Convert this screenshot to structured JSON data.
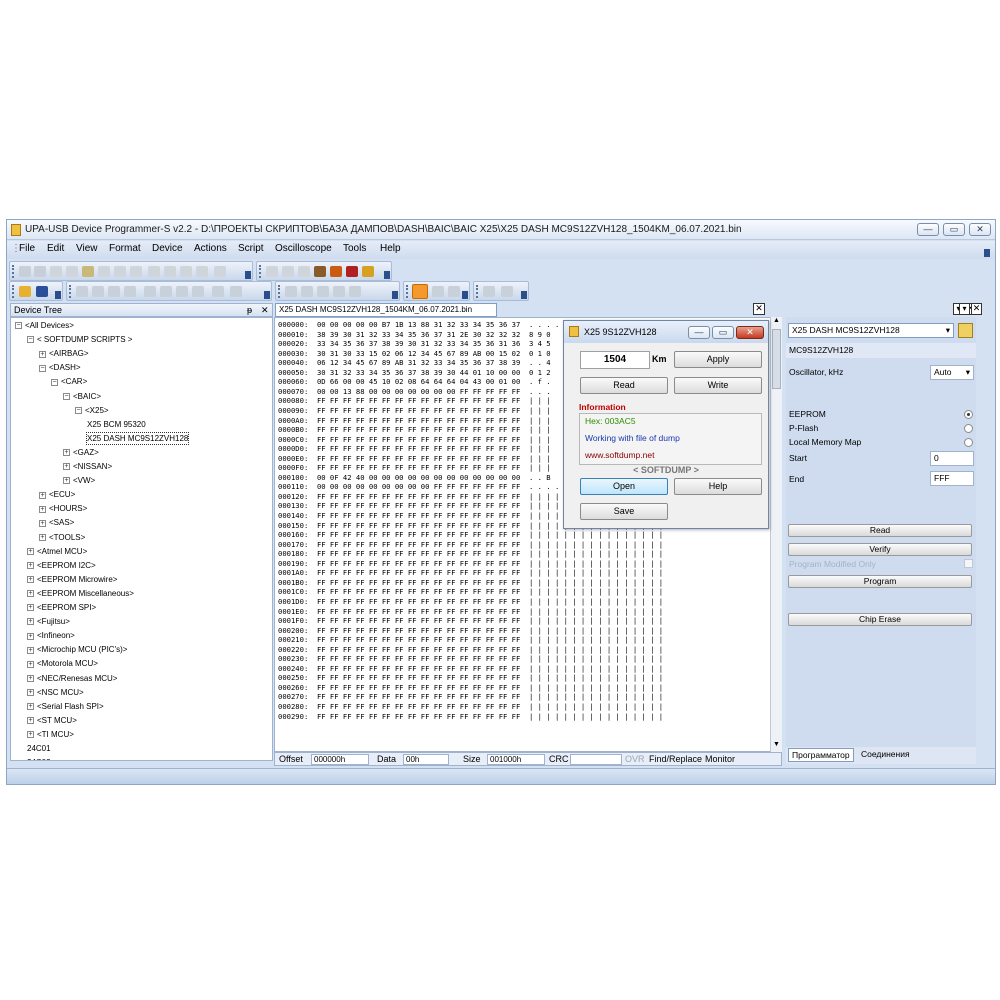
{
  "window": {
    "title": "UPA-USB Device Programmer-S v2.2 - D:\\ПРОЕКТЫ СКРИПТОВ\\БАЗА ДАМПОВ\\DASH\\BAIC\\BAIC X25\\X25 DASH MC9S12ZVH128_1504KM_06.07.2021.bin",
    "minimize": "—",
    "maximize": "▭",
    "close": "✕"
  },
  "menu": [
    "File",
    "Edit",
    "View",
    "Format",
    "Device",
    "Actions",
    "Script",
    "Oscilloscope",
    "Tools",
    "Help"
  ],
  "device_tree": {
    "title": "Device Tree",
    "pin": "ᵽ",
    "close": "✕",
    "nodes": [
      {
        "label": "<All Devices>",
        "level": 0,
        "box": "−"
      },
      {
        "label": "< SOFTDUMP SCRIPTS >",
        "level": 1,
        "box": "−"
      },
      {
        "label": "<AIRBAG>",
        "level": 2,
        "box": "+"
      },
      {
        "label": "<DASH>",
        "level": 2,
        "box": "−"
      },
      {
        "label": "<CAR>",
        "level": 3,
        "box": "−"
      },
      {
        "label": "<BAIC>",
        "level": 4,
        "box": "−"
      },
      {
        "label": "<X25>",
        "level": 5,
        "box": "−"
      },
      {
        "label": "X25 BCM 95320",
        "level": 6,
        "box": ""
      },
      {
        "label": "X25 DASH MC9S12ZVH128",
        "level": 6,
        "box": "",
        "selected": true
      },
      {
        "label": "<GAZ>",
        "level": 4,
        "box": "+"
      },
      {
        "label": "<NISSAN>",
        "level": 4,
        "box": "+"
      },
      {
        "label": "<VW>",
        "level": 4,
        "box": "+"
      },
      {
        "label": "<ECU>",
        "level": 2,
        "box": "+"
      },
      {
        "label": "<HOURS>",
        "level": 2,
        "box": "+"
      },
      {
        "label": "<SAS>",
        "level": 2,
        "box": "+"
      },
      {
        "label": "<TOOLS>",
        "level": 2,
        "box": "+"
      },
      {
        "label": "<Atmel MCU>",
        "level": 1,
        "box": "+"
      },
      {
        "label": "<EEPROM I2C>",
        "level": 1,
        "box": "+"
      },
      {
        "label": "<EEPROM Microwire>",
        "level": 1,
        "box": "+"
      },
      {
        "label": "<EEPROM Miscellaneous>",
        "level": 1,
        "box": "+"
      },
      {
        "label": "<EEPROM SPI>",
        "level": 1,
        "box": "+"
      },
      {
        "label": "<Fujitsu>",
        "level": 1,
        "box": "+"
      },
      {
        "label": "<Infineon>",
        "level": 1,
        "box": "+"
      },
      {
        "label": "<Microchip MCU (PIC's)>",
        "level": 1,
        "box": "+"
      },
      {
        "label": "<Motorola MCU>",
        "level": 1,
        "box": "+"
      },
      {
        "label": "<NEC/Renesas MCU>",
        "level": 1,
        "box": "+"
      },
      {
        "label": "<NSC MCU>",
        "level": 1,
        "box": "+"
      },
      {
        "label": "<Serial Flash SPI>",
        "level": 1,
        "box": "+"
      },
      {
        "label": "<ST MCU>",
        "level": 1,
        "box": "+"
      },
      {
        "label": "<TI MCU>",
        "level": 1,
        "box": "+"
      },
      {
        "label": "24C01",
        "level": 1,
        "box": ""
      },
      {
        "label": "24C02",
        "level": 1,
        "box": ""
      }
    ]
  },
  "editor": {
    "tab_label": "X25 DASH MC9S12ZVH128_1504KM_06.07.2021.bin",
    "tab_close": "✕",
    "hex_rows": [
      "000000:  00 00 00 00 00 B7 1B 13 88 31 32 33 34 35 36 37  . . . .",
      "000010:  38 39 30 31 32 33 34 35 36 37 31 2E 30 32 32 32  8 9 0",
      "000020:  33 34 35 36 37 38 39 30 31 32 33 34 35 36 31 36  3 4 5",
      "000030:  30 31 30 33 15 02 06 12 34 45 67 89 AB 00 15 02  0 1 0",
      "000040:  06 12 34 45 67 89 AB 31 32 33 34 35 36 37 38 39  . . 4",
      "000050:  30 31 32 33 34 35 36 37 38 39 30 44 01 10 00 00  0 1 2",
      "000060:  0D 66 00 00 45 10 02 08 64 64 64 04 43 00 01 00  . f .",
      "000070:  00 00 13 88 00 00 00 00 00 00 00 FF FF FF FF FF  . . .",
      "000080:  FF FF FF FF FF FF FF FF FF FF FF FF FF FF FF FF  | | |",
      "000090:  FF FF FF FF FF FF FF FF FF FF FF FF FF FF FF FF  | | |",
      "0000A0:  FF FF FF FF FF FF FF FF FF FF FF FF FF FF FF FF  | | |",
      "0000B0:  FF FF FF FF FF FF FF FF FF FF FF FF FF FF FF FF  | | |",
      "0000C0:  FF FF FF FF FF FF FF FF FF FF FF FF FF FF FF FF  | | |",
      "0000D0:  FF FF FF FF FF FF FF FF FF FF FF FF FF FF FF FF  | | |",
      "0000E0:  FF FF FF FF FF FF FF FF FF FF FF FF FF FF FF FF  | | |",
      "0000F0:  FF FF FF FF FF FF FF FF FF FF FF FF FF FF FF FF  | | |",
      "000100:  00 0F 42 40 00 00 00 00 00 00 00 00 00 00 00 00  . . B",
      "000110:  00 00 00 00 00 00 00 00 00 FF FF FF FF FF FF FF  . . . . . . . . . | | | | | | |",
      "000120:  FF FF FF FF FF FF FF FF FF FF FF FF FF FF FF FF  | | | | | | | | | | | | | | | |",
      "000130:  FF FF FF FF FF FF FF FF FF FF FF FF FF FF FF FF  | | | | | | | | | | | | | | | |",
      "000140:  FF FF FF FF FF FF FF FF FF FF FF FF FF FF FF FF  | | | | | | | | | | | | | | | |",
      "000150:  FF FF FF FF FF FF FF FF FF FF FF FF FF FF FF FF  | | | | | | | | | | | | | | | |",
      "000160:  FF FF FF FF FF FF FF FF FF FF FF FF FF FF FF FF  | | | | | | | | | | | | | | | |",
      "000170:  FF FF FF FF FF FF FF FF FF FF FF FF FF FF FF FF  | | | | | | | | | | | | | | | |",
      "000180:  FF FF FF FF FF FF FF FF FF FF FF FF FF FF FF FF  | | | | | | | | | | | | | | | |",
      "000190:  FF FF FF FF FF FF FF FF FF FF FF FF FF FF FF FF  | | | | | | | | | | | | | | | |",
      "0001A0:  FF FF FF FF FF FF FF FF FF FF FF FF FF FF FF FF  | | | | | | | | | | | | | | | |",
      "0001B0:  FF FF FF FF FF FF FF FF FF FF FF FF FF FF FF FF  | | | | | | | | | | | | | | | |",
      "0001C0:  FF FF FF FF FF FF FF FF FF FF FF FF FF FF FF FF  | | | | | | | | | | | | | | | |",
      "0001D0:  FF FF FF FF FF FF FF FF FF FF FF FF FF FF FF FF  | | | | | | | | | | | | | | | |",
      "0001E0:  FF FF FF FF FF FF FF FF FF FF FF FF FF FF FF FF  | | | | | | | | | | | | | | | |",
      "0001F0:  FF FF FF FF FF FF FF FF FF FF FF FF FF FF FF FF  | | | | | | | | | | | | | | | |",
      "000200:  FF FF FF FF FF FF FF FF FF FF FF FF FF FF FF FF  | | | | | | | | | | | | | | | |",
      "000210:  FF FF FF FF FF FF FF FF FF FF FF FF FF FF FF FF  | | | | | | | | | | | | | | | |",
      "000220:  FF FF FF FF FF FF FF FF FF FF FF FF FF FF FF FF  | | | | | | | | | | | | | | | |",
      "000230:  FF FF FF FF FF FF FF FF FF FF FF FF FF FF FF FF  | | | | | | | | | | | | | | | |",
      "000240:  FF FF FF FF FF FF FF FF FF FF FF FF FF FF FF FF  | | | | | | | | | | | | | | | |",
      "000250:  FF FF FF FF FF FF FF FF FF FF FF FF FF FF FF FF  | | | | | | | | | | | | | | | |",
      "000260:  FF FF FF FF FF FF FF FF FF FF FF FF FF FF FF FF  | | | | | | | | | | | | | | | |",
      "000270:  FF FF FF FF FF FF FF FF FF FF FF FF FF FF FF FF  | | | | | | | | | | | | | | | |",
      "000280:  FF FF FF FF FF FF FF FF FF FF FF FF FF FF FF FF  | | | | | | | | | | | | | | | |",
      "000290:  FF FF FF FF FF FF FF FF FF FF FF FF FF FF FF FF  | | | | | | | | | | | | | | | |"
    ],
    "status": {
      "offset_label": "Offset",
      "offset_value": "000000h",
      "data_label": "Data",
      "data_value": "00h",
      "size_label": "Size",
      "size_value": "001000h",
      "crc_label": "CRC",
      "crc_value": "",
      "ovr_label": "OVR",
      "find_label": "Find/Replace",
      "monitor_label": "Monitor"
    }
  },
  "dialog": {
    "title": "X25 9S12ZVH128",
    "km_value": "1504",
    "km_unit": "Km",
    "apply": "Apply",
    "read": "Read",
    "write": "Write",
    "info_heading": "Information",
    "hex_line": "Hex: 003AC5",
    "working_line": "Working with file of dump",
    "url_line": "www.softdump.net",
    "brand": "< SOFTDUMP >",
    "open": "Open",
    "help": "Help",
    "save": "Save"
  },
  "right_panel": {
    "device_select": "X25 DASH MC9S12ZVH128",
    "device_name": "MC9S12ZVH128",
    "oscillator_label": "Oscillator, kHz",
    "oscillator_value": "Auto",
    "eeprom": "EEPROM",
    "pflash": "P-Flash",
    "local_memory": "Local Memory Map",
    "start_label": "Start",
    "start_value": "0",
    "end_label": "End",
    "end_value": "FFF",
    "read": "Read",
    "verify": "Verify",
    "program_modified": "Program Modified Only",
    "program": "Program",
    "chip_erase": "Chip Erase",
    "tab_programmer": "Программатор",
    "tab_connections": "Соединения"
  },
  "colors": {
    "window_bg": "#d4e1f2",
    "info_red": "#c00000",
    "info_green": "#2e8b00",
    "info_blue": "#1a38b0",
    "link_red": "#8b0000"
  }
}
